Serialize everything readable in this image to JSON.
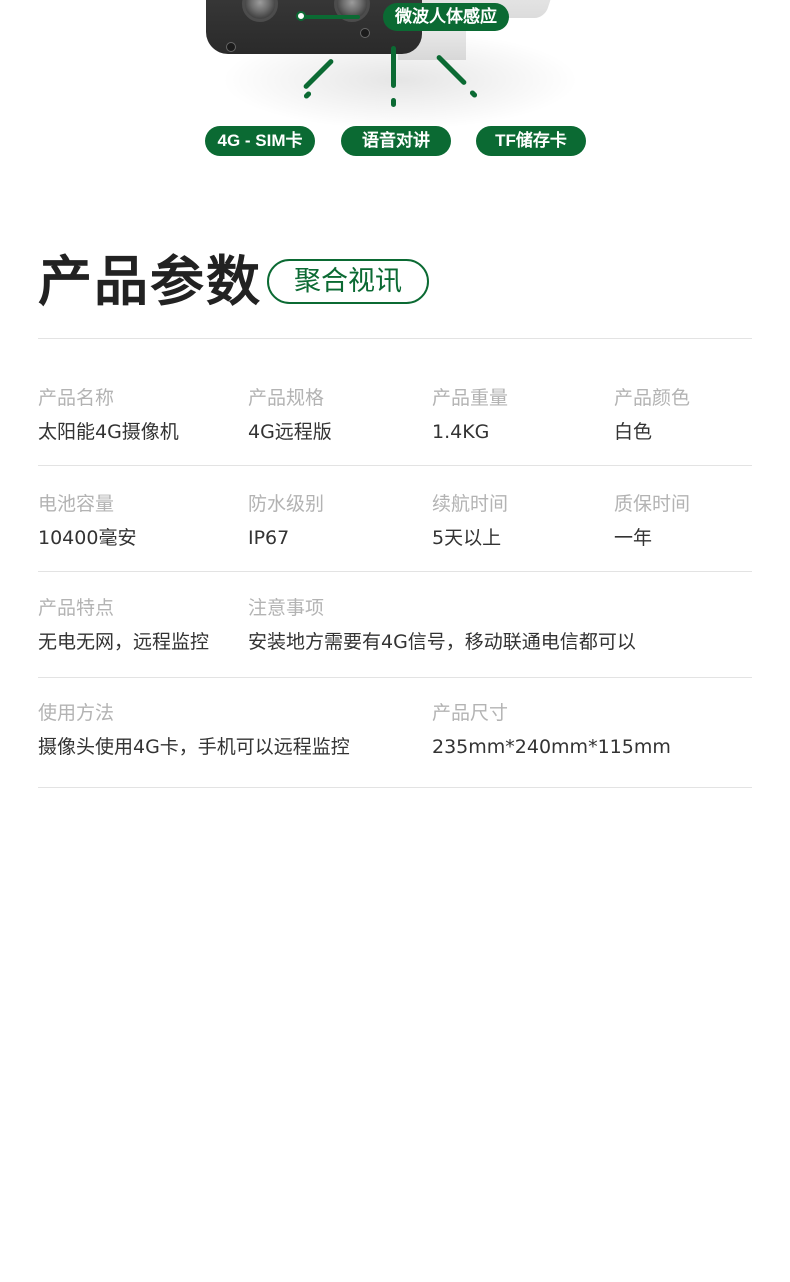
{
  "colors": {
    "brand_green": "#0b6a33",
    "label_gray": "#b3b3b3",
    "value_dark": "#333333",
    "divider": "#e3e3e3"
  },
  "hero": {
    "features": {
      "top": "微波人体感应",
      "sim": "4G - SIM卡",
      "voice": "语音对讲",
      "tf": "TF储存卡"
    }
  },
  "section": {
    "title": "产品参数",
    "brand": "聚合视讯"
  },
  "specs": {
    "row1": [
      {
        "label": "产品名称",
        "value": "太阳能4G摄像机"
      },
      {
        "label": "产品规格",
        "value": "4G远程版"
      },
      {
        "label": "产品重量",
        "value": "1.4KG"
      },
      {
        "label": "产品颜色",
        "value": "白色"
      }
    ],
    "row2": [
      {
        "label": "电池容量",
        "value": "10400毫安"
      },
      {
        "label": "防水级别",
        "value": "IP67"
      },
      {
        "label": "续航时间",
        "value": "5天以上"
      },
      {
        "label": "质保时间",
        "value": "一年"
      }
    ],
    "row3": [
      {
        "label": "产品特点",
        "value": "无电无网，远程监控"
      },
      {
        "label": "注意事项",
        "value": "安装地方需要有4G信号，移动联通电信都可以"
      }
    ],
    "row4": [
      {
        "label": "使用方法",
        "value": "摄像头使用4G卡，手机可以远程监控"
      },
      {
        "label": "产品尺寸",
        "value": "235mm*240mm*115mm"
      }
    ]
  }
}
